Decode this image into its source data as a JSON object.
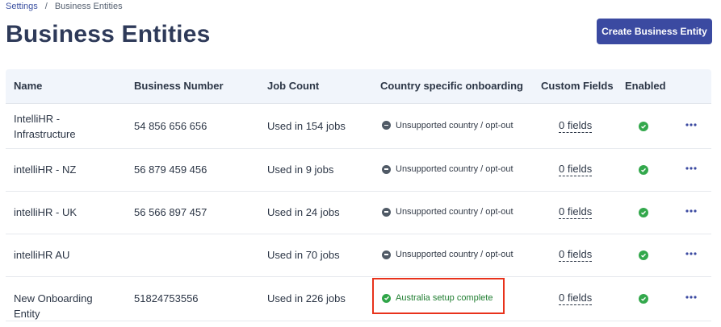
{
  "breadcrumb": {
    "parent": "Settings",
    "separator": "/",
    "current": "Business Entities"
  },
  "page_title": "Business Entities",
  "create_button": "Create Business Entity",
  "table": {
    "headers": [
      "Name",
      "Business Number",
      "Job Count",
      "Country specific onboarding",
      "Custom Fields",
      "Enabled"
    ],
    "rows": [
      {
        "name": "IntelliHR - Infrastructure",
        "business_number": "54 856 656 656",
        "job_count": "Used in 154 jobs",
        "onboarding": "Unsupported country / opt-out",
        "onboarding_status": "unsupported",
        "custom_fields": "0 fields",
        "enabled": true
      },
      {
        "name": "intelliHR - NZ",
        "business_number": "56 879 459 456",
        "job_count": "Used in 9 jobs",
        "onboarding": "Unsupported country / opt-out",
        "onboarding_status": "unsupported",
        "custom_fields": "0 fields",
        "enabled": true
      },
      {
        "name": "intelliHR - UK",
        "business_number": "56 566 897 457",
        "job_count": "Used in 24 jobs",
        "onboarding": "Unsupported country / opt-out",
        "onboarding_status": "unsupported",
        "custom_fields": "0 fields",
        "enabled": true
      },
      {
        "name": "intelliHR AU",
        "business_number": "",
        "job_count": "Used in 70 jobs",
        "onboarding": "Unsupported country / opt-out",
        "onboarding_status": "unsupported",
        "custom_fields": "0 fields",
        "enabled": true
      },
      {
        "name": "New Onboarding Entity",
        "business_number": "51824753556",
        "job_count": "Used in 226 jobs",
        "onboarding": "Australia setup complete",
        "onboarding_status": "complete",
        "custom_fields": "0 fields",
        "enabled": true
      }
    ]
  },
  "colors": {
    "primary": "#3b4aa1",
    "success": "#2fa548",
    "neutral_icon": "#505a66",
    "highlight": "#e8321b",
    "header_bg": "#f1f5fb"
  }
}
